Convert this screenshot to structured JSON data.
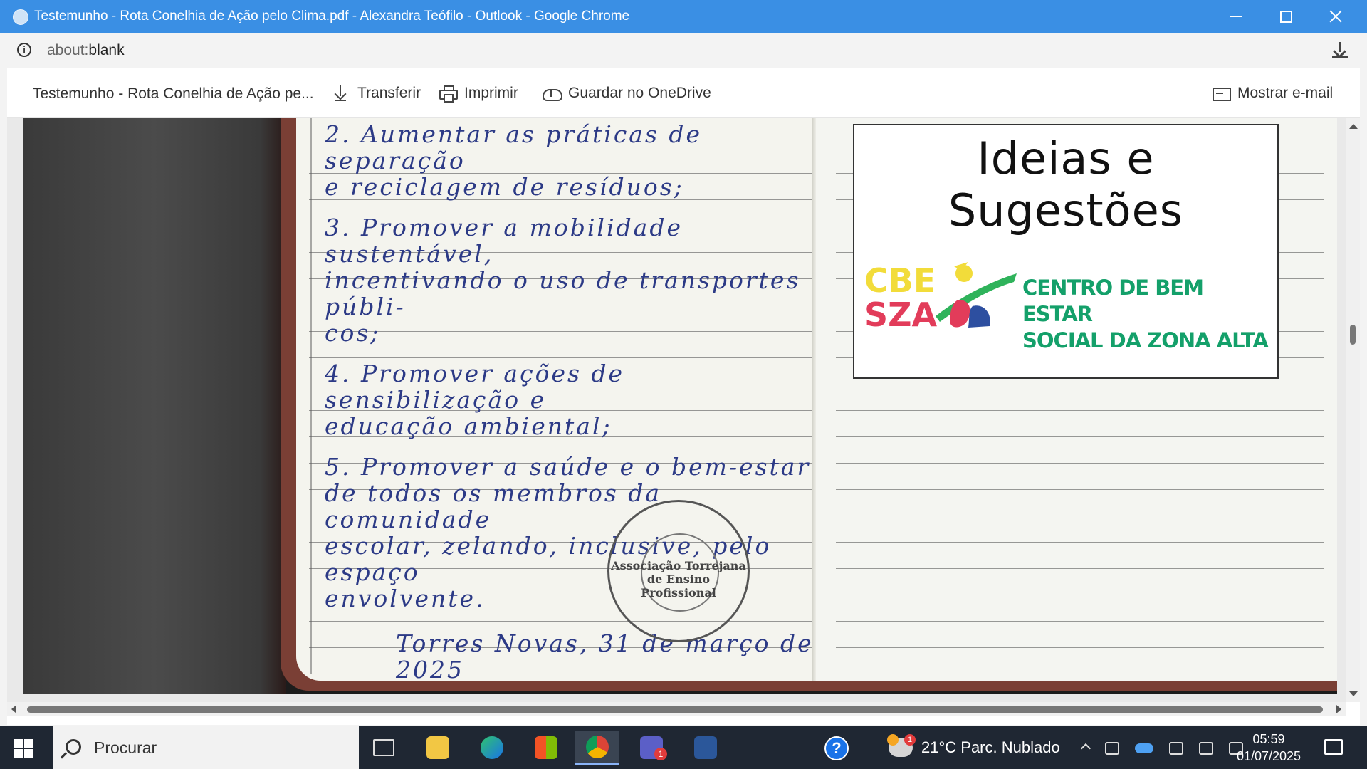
{
  "window": {
    "title": "Testemunho - Rota Conelhia de Ação pelo Clima.pdf - Alexandra Teófilo - Outlook - Google Chrome"
  },
  "address_bar": {
    "scheme": "about:",
    "rest": "blank"
  },
  "viewer": {
    "file_name": "Testemunho - Rota Conelhia de Ação pe...",
    "download_label": "Transferir",
    "print_label": "Imprimir",
    "onedrive_label": "Guardar no OneDrive",
    "show_email_label": "Mostrar e-mail"
  },
  "document": {
    "left_page": {
      "items": [
        {
          "line1": "2. Aumentar as práticas de separação",
          "line2": "e reciclagem de resíduos;"
        },
        {
          "line1": "3. Promover a mobilidade sustentável,",
          "line2": "incentivando o uso de transportes públi-",
          "line3": "cos;"
        },
        {
          "line1": "4. Promover ações de sensibilização e",
          "line2": "educação ambiental;"
        },
        {
          "line1": "5. Promover a saúde e o bem-estar",
          "line2": "de todos os membros da comunidade",
          "line3": "escolar, zelando, inclusive, pelo espaço",
          "line4": "envolvente."
        }
      ],
      "signature": "Torres Novas, 31 de março de 2025",
      "stamp_text": "Associação Torrejana de Ensino Profissional"
    },
    "right_page": {
      "card_title": "Ideias e Sugestões",
      "logo_abbr_1": "CBE",
      "logo_abbr_2": "SZA",
      "logo_name_1": "CENTRO DE BEM ESTAR",
      "logo_name_2": "SOCIAL DA ZONA ALTA"
    }
  },
  "taskbar": {
    "search_placeholder": "Procurar",
    "teams_badge": "1",
    "weather_alert": "1",
    "weather": "21°C  Parc. Nublado",
    "time": "05:59",
    "date": "01/07/2025"
  }
}
